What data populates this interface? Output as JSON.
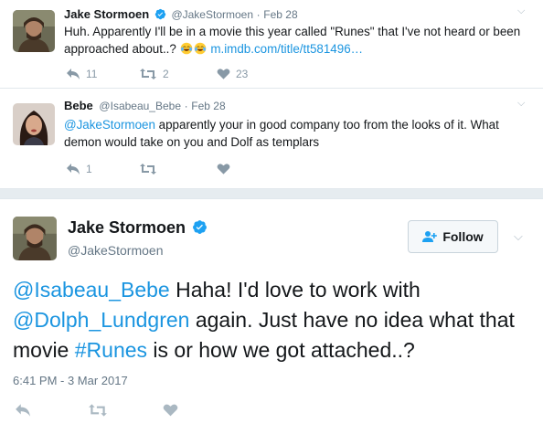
{
  "tweets": [
    {
      "name": "Jake Stormoen",
      "handle": "@JakeStormoen",
      "date": "Feb 28",
      "text": "Huh. Apparently I'll be in a movie this year called \"Runes\" that I've not heard or been approached about..?",
      "link": "m.imdb.com/title/tt581496…",
      "replies": "11",
      "retweets": "2",
      "likes": "23"
    },
    {
      "name": "Bebe",
      "handle": "@Isabeau_Bebe",
      "date": "Feb 28",
      "mention": "@JakeStormoen",
      "text": " apparently your in good company too from the looks of it. What demon would take on you and Dolf as templars",
      "replies": "1"
    }
  ],
  "main_tweet": {
    "name": "Jake Stormoen",
    "handle": "@JakeStormoen",
    "follow_label": "Follow",
    "mention1": "@Isabeau_Bebe",
    "text1": " Haha! I'd love to work with ",
    "mention2": "@Dolph_Lundgren",
    "text2": " again. Just have no idea what that movie ",
    "hashtag": "#Runes",
    "text3": " is or how we got attached..?",
    "timestamp": "6:41 PM - 3 Mar 2017"
  },
  "icons": {
    "verified": "verified-badge-icon",
    "reply": "reply-icon",
    "retweet": "retweet-icon",
    "like": "heart-icon",
    "more": "chevron-down-icon",
    "follow": "add-user-icon",
    "emoji": "face-with-tears-of-joy-icon"
  },
  "colors": {
    "link": "#1b95e0",
    "verified": "#1da1f2",
    "icon_gray": "#aab8c2",
    "divider": "#e6ecf0"
  }
}
